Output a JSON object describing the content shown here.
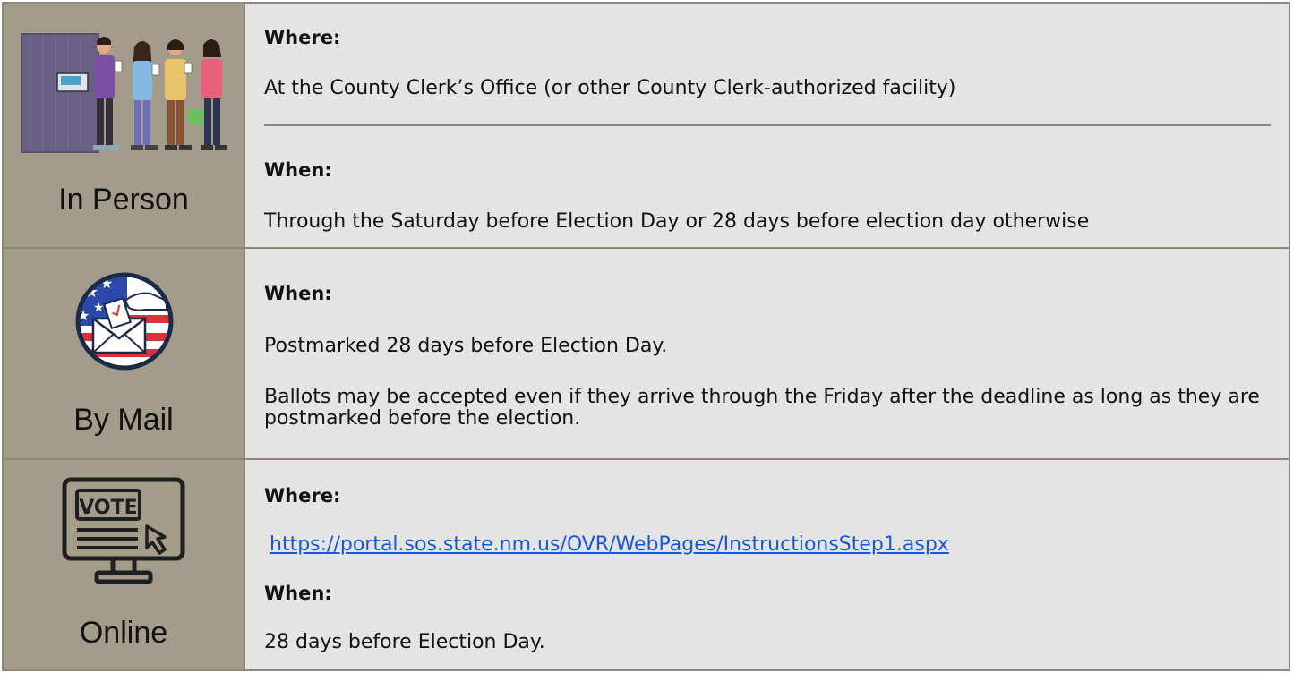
{
  "rows": [
    {
      "category": "In Person",
      "icon": "voters-in-line-illustration",
      "where_heading": "Where:",
      "where_text": "At the County Clerk’s Office (or other County Clerk-authorized facility)",
      "when_heading": "When:",
      "when_text": "Through the Saturday before Election Day or 28 days before election day otherwise"
    },
    {
      "category": "By Mail",
      "icon": "mail-ballot-flag-icon",
      "when_heading": "When:",
      "when_text": "Postmarked 28 days before Election Day.",
      "note_text": "Ballots may be accepted even if they arrive through the Friday after the deadline as long as they are postmarked before the election."
    },
    {
      "category": "Online",
      "icon": "vote-computer-icon",
      "icon_text": "VOTE",
      "where_heading": "Where:",
      "link": "https://portal.sos.state.nm.us/OVR/WebPages/InstructionsStep1.aspx",
      "when_heading": "When:",
      "when_text": "28 days before Election Day."
    }
  ],
  "colors": {
    "left_cell_bg": "#a39c8b",
    "right_cell_bg": "#e4e4e4",
    "border": "#8d8778",
    "link": "#1a55d6"
  }
}
